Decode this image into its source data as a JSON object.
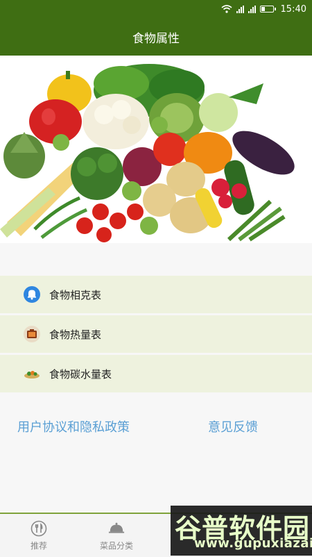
{
  "status_bar": {
    "time": "15:40"
  },
  "title": "食物属性",
  "hero": {
    "alt_icon": "vegetables-photo"
  },
  "menu": [
    {
      "label": "食物相克表",
      "icon": "bell-icon"
    },
    {
      "label": "食物热量表",
      "icon": "box-icon"
    },
    {
      "label": "食物碳水量表",
      "icon": "tray-icon"
    }
  ],
  "links": {
    "agreement": "用户协议和隐私政策",
    "feedback": "意见反馈"
  },
  "bottom_nav": [
    {
      "label": "推荐",
      "icon": "fork-knife-icon"
    },
    {
      "label": "菜品分类",
      "icon": "cloche-icon"
    }
  ],
  "watermark": {
    "text": "谷普软件园",
    "url": "www.gupuxiazai.com"
  },
  "colors": {
    "header": "#3f6e13",
    "menu_bg": "#eef2de",
    "link": "#5a9fd4"
  }
}
